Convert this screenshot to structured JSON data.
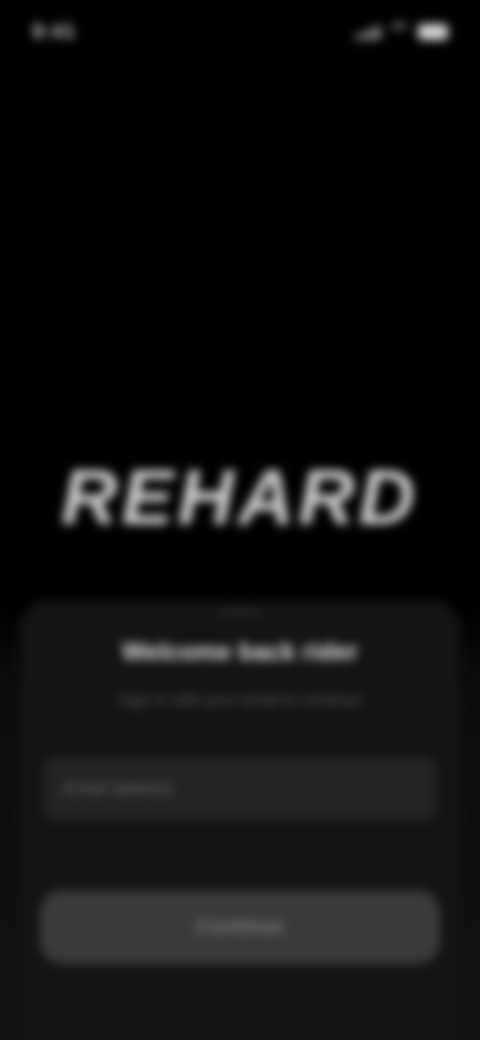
{
  "status_bar": {
    "time": "9:41",
    "icons": [
      "signal-icon",
      "wifi-icon",
      "battery-icon"
    ]
  },
  "brand": {
    "logo_text": "REHARD"
  },
  "login": {
    "title": "Welcome back rider",
    "subtitle": "Sign in with your email to continue",
    "email_placeholder": "Email address",
    "continue_label": "Continue"
  },
  "colors": {
    "background": "#000000",
    "panel": "#141414",
    "field": "#242424",
    "button": "#3a3a3a",
    "text_primary": "#e6e6e6",
    "text_secondary": "#5c5c5c"
  }
}
